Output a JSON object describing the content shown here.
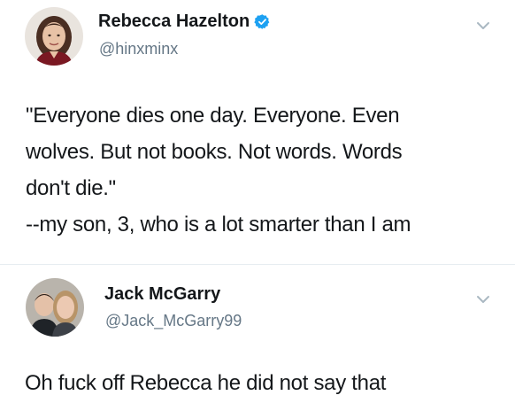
{
  "tweets": [
    {
      "display_name": "Rebecca Hazelton",
      "handle": "@hinxminx",
      "verified": true,
      "text_lines": [
        "\"Everyone dies one day. Everyone. Even",
        "wolves. But not books. Not words. Words",
        "don't die.\"",
        "--my son, 3, who is a lot smarter than I am"
      ]
    },
    {
      "display_name": "Jack McGarry",
      "handle": "@Jack_McGarry99",
      "verified": false,
      "text_lines": [
        "Oh fuck off Rebecca he did not say that"
      ]
    }
  ],
  "colors": {
    "verified_badge": "#1da1f2",
    "handle": "#657786",
    "text": "#14171a",
    "chevron": "#aab8c2"
  },
  "icons": {
    "verified": "verified-badge-icon",
    "caret": "chevron-down-icon"
  }
}
